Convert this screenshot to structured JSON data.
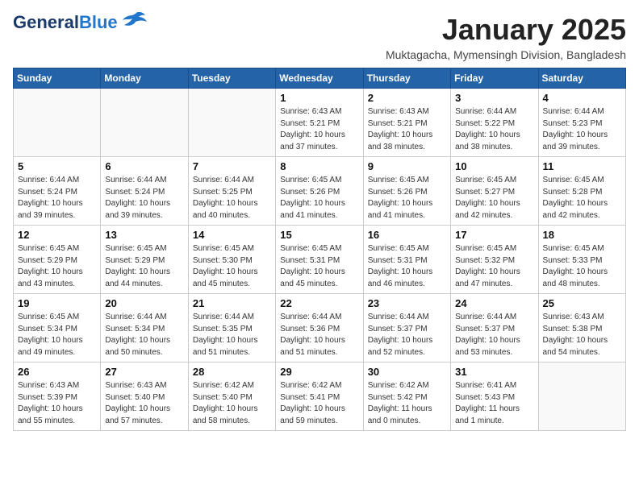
{
  "logo": {
    "line1": "General",
    "line2": "Blue"
  },
  "title": "January 2025",
  "subtitle": "Muktagacha, Mymensingh Division, Bangladesh",
  "header_days": [
    "Sunday",
    "Monday",
    "Tuesday",
    "Wednesday",
    "Thursday",
    "Friday",
    "Saturday"
  ],
  "weeks": [
    [
      {
        "day": "",
        "info": ""
      },
      {
        "day": "",
        "info": ""
      },
      {
        "day": "",
        "info": ""
      },
      {
        "day": "1",
        "info": "Sunrise: 6:43 AM\nSunset: 5:21 PM\nDaylight: 10 hours\nand 37 minutes."
      },
      {
        "day": "2",
        "info": "Sunrise: 6:43 AM\nSunset: 5:21 PM\nDaylight: 10 hours\nand 38 minutes."
      },
      {
        "day": "3",
        "info": "Sunrise: 6:44 AM\nSunset: 5:22 PM\nDaylight: 10 hours\nand 38 minutes."
      },
      {
        "day": "4",
        "info": "Sunrise: 6:44 AM\nSunset: 5:23 PM\nDaylight: 10 hours\nand 39 minutes."
      }
    ],
    [
      {
        "day": "5",
        "info": "Sunrise: 6:44 AM\nSunset: 5:24 PM\nDaylight: 10 hours\nand 39 minutes."
      },
      {
        "day": "6",
        "info": "Sunrise: 6:44 AM\nSunset: 5:24 PM\nDaylight: 10 hours\nand 39 minutes."
      },
      {
        "day": "7",
        "info": "Sunrise: 6:44 AM\nSunset: 5:25 PM\nDaylight: 10 hours\nand 40 minutes."
      },
      {
        "day": "8",
        "info": "Sunrise: 6:45 AM\nSunset: 5:26 PM\nDaylight: 10 hours\nand 41 minutes."
      },
      {
        "day": "9",
        "info": "Sunrise: 6:45 AM\nSunset: 5:26 PM\nDaylight: 10 hours\nand 41 minutes."
      },
      {
        "day": "10",
        "info": "Sunrise: 6:45 AM\nSunset: 5:27 PM\nDaylight: 10 hours\nand 42 minutes."
      },
      {
        "day": "11",
        "info": "Sunrise: 6:45 AM\nSunset: 5:28 PM\nDaylight: 10 hours\nand 42 minutes."
      }
    ],
    [
      {
        "day": "12",
        "info": "Sunrise: 6:45 AM\nSunset: 5:29 PM\nDaylight: 10 hours\nand 43 minutes."
      },
      {
        "day": "13",
        "info": "Sunrise: 6:45 AM\nSunset: 5:29 PM\nDaylight: 10 hours\nand 44 minutes."
      },
      {
        "day": "14",
        "info": "Sunrise: 6:45 AM\nSunset: 5:30 PM\nDaylight: 10 hours\nand 45 minutes."
      },
      {
        "day": "15",
        "info": "Sunrise: 6:45 AM\nSunset: 5:31 PM\nDaylight: 10 hours\nand 45 minutes."
      },
      {
        "day": "16",
        "info": "Sunrise: 6:45 AM\nSunset: 5:31 PM\nDaylight: 10 hours\nand 46 minutes."
      },
      {
        "day": "17",
        "info": "Sunrise: 6:45 AM\nSunset: 5:32 PM\nDaylight: 10 hours\nand 47 minutes."
      },
      {
        "day": "18",
        "info": "Sunrise: 6:45 AM\nSunset: 5:33 PM\nDaylight: 10 hours\nand 48 minutes."
      }
    ],
    [
      {
        "day": "19",
        "info": "Sunrise: 6:45 AM\nSunset: 5:34 PM\nDaylight: 10 hours\nand 49 minutes."
      },
      {
        "day": "20",
        "info": "Sunrise: 6:44 AM\nSunset: 5:34 PM\nDaylight: 10 hours\nand 50 minutes."
      },
      {
        "day": "21",
        "info": "Sunrise: 6:44 AM\nSunset: 5:35 PM\nDaylight: 10 hours\nand 51 minutes."
      },
      {
        "day": "22",
        "info": "Sunrise: 6:44 AM\nSunset: 5:36 PM\nDaylight: 10 hours\nand 51 minutes."
      },
      {
        "day": "23",
        "info": "Sunrise: 6:44 AM\nSunset: 5:37 PM\nDaylight: 10 hours\nand 52 minutes."
      },
      {
        "day": "24",
        "info": "Sunrise: 6:44 AM\nSunset: 5:37 PM\nDaylight: 10 hours\nand 53 minutes."
      },
      {
        "day": "25",
        "info": "Sunrise: 6:43 AM\nSunset: 5:38 PM\nDaylight: 10 hours\nand 54 minutes."
      }
    ],
    [
      {
        "day": "26",
        "info": "Sunrise: 6:43 AM\nSunset: 5:39 PM\nDaylight: 10 hours\nand 55 minutes."
      },
      {
        "day": "27",
        "info": "Sunrise: 6:43 AM\nSunset: 5:40 PM\nDaylight: 10 hours\nand 57 minutes."
      },
      {
        "day": "28",
        "info": "Sunrise: 6:42 AM\nSunset: 5:40 PM\nDaylight: 10 hours\nand 58 minutes."
      },
      {
        "day": "29",
        "info": "Sunrise: 6:42 AM\nSunset: 5:41 PM\nDaylight: 10 hours\nand 59 minutes."
      },
      {
        "day": "30",
        "info": "Sunrise: 6:42 AM\nSunset: 5:42 PM\nDaylight: 11 hours\nand 0 minutes."
      },
      {
        "day": "31",
        "info": "Sunrise: 6:41 AM\nSunset: 5:43 PM\nDaylight: 11 hours\nand 1 minute."
      },
      {
        "day": "",
        "info": ""
      }
    ]
  ]
}
